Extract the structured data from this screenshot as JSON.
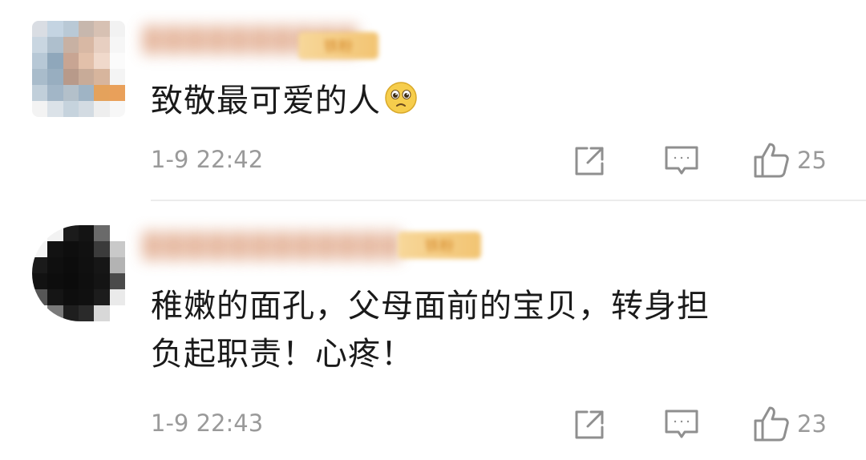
{
  "comments": [
    {
      "username": "██████████",
      "badge_text": "铁粉",
      "text": "致敬最可爱的人",
      "emoji": "teary-face-emoji",
      "timestamp": "1-9 22:42",
      "like_count": "25"
    },
    {
      "username": "████████████",
      "badge_text": "铁粉",
      "text_line1": "稚嫩的面孔，父母面前的宝贝，转身担",
      "text_line2": "负起职责！心疼！",
      "timestamp": "1-9 22:43",
      "like_count": "23"
    }
  ],
  "colors": {
    "text": "#1a1a1a",
    "meta": "#9a9a9a",
    "badge": "#f2c472"
  },
  "icons": [
    "share-icon",
    "reply-icon",
    "like-icon"
  ]
}
